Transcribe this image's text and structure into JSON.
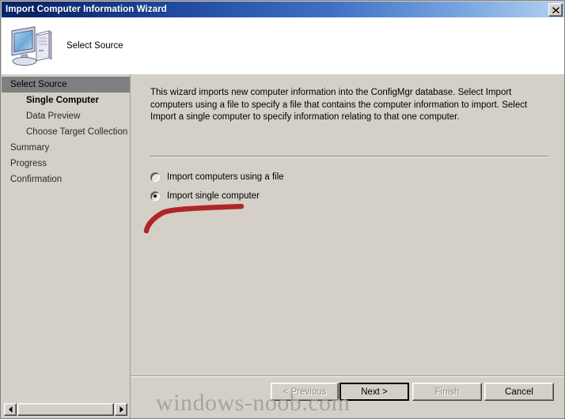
{
  "window": {
    "title": "Import Computer Information Wizard",
    "close_icon": "close-icon"
  },
  "header": {
    "icon": "computer-icon",
    "page_title": "Select Source"
  },
  "sidebar": {
    "steps": [
      {
        "label": "Select Source",
        "level": 0,
        "state": "selected"
      },
      {
        "label": "Single Computer",
        "level": 1,
        "state": "active"
      },
      {
        "label": "Data Preview",
        "level": 1,
        "state": "normal"
      },
      {
        "label": "Choose Target Collection",
        "level": 1,
        "state": "normal"
      },
      {
        "label": "Summary",
        "level": 0,
        "state": "normal"
      },
      {
        "label": "Progress",
        "level": 0,
        "state": "normal"
      },
      {
        "label": "Confirmation",
        "level": 0,
        "state": "normal"
      }
    ],
    "scrollbar": {
      "left_arrow_icon": "triangle-left-icon",
      "right_arrow_icon": "triangle-right-icon"
    }
  },
  "content": {
    "description": "This wizard imports new computer information into the ConfigMgr database. Select Import computers using a file to specify a file that contains the computer information to import. Select Import a single computer to specify information relating to that one computer.",
    "options": [
      {
        "label": "Import computers using a file",
        "selected": false
      },
      {
        "label": "Import single computer",
        "selected": true
      }
    ],
    "annotation": {
      "type": "hand-drawn-arrow",
      "color": "#b02626"
    }
  },
  "footer": {
    "buttons": [
      {
        "label": "< Previous",
        "enabled": false,
        "default": false
      },
      {
        "label": "Next >",
        "enabled": true,
        "default": true
      },
      {
        "label": "Finish",
        "enabled": false,
        "default": false
      },
      {
        "label": "Cancel",
        "enabled": true,
        "default": false
      }
    ]
  },
  "watermark": {
    "text": "windows-noob.com"
  },
  "colors": {
    "titlebar_start": "#0a246a",
    "titlebar_end": "#b8d4f2",
    "dialog_face": "#d4d0c8",
    "selection": "#808080",
    "annotation_red": "#b02626",
    "watermark_gray": "#a7a49c"
  }
}
